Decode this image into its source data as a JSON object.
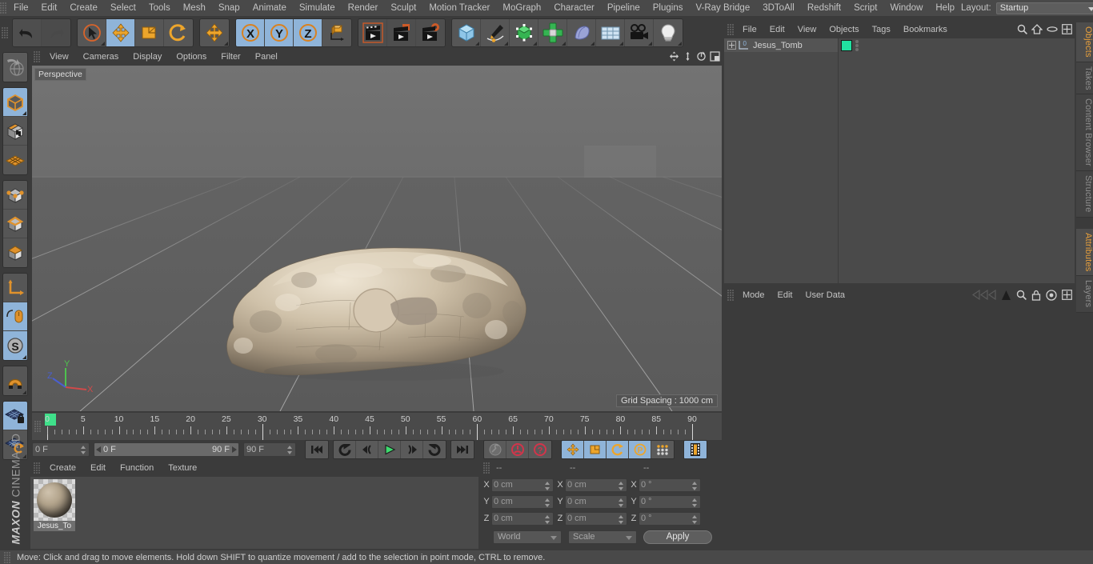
{
  "app": {
    "title": "MAXON CINEMA 4D",
    "brand_line1": "MAXON",
    "brand_line2": "CINEMA 4D"
  },
  "menubar": {
    "items": [
      "File",
      "Edit",
      "Create",
      "Select",
      "Tools",
      "Mesh",
      "Snap",
      "Animate",
      "Simulate",
      "Render",
      "Sculpt",
      "Motion Tracker",
      "MoGraph",
      "Character",
      "Pipeline",
      "Plugins",
      "V-Ray Bridge",
      "3DToAll",
      "Redshift",
      "Script",
      "Window",
      "Help"
    ],
    "layout_label": "Layout:",
    "layout_value": "Startup",
    "search_icon": "search-icon",
    "home_icon": "home-icon",
    "minimize_icon": "minimize-icon",
    "maximize_icon": "maximize-icon"
  },
  "toolbar": {
    "groups": [
      {
        "name": "undo-redo",
        "buttons": [
          {
            "name": "undo-button",
            "icon": "undo-icon",
            "state": "normal"
          },
          {
            "name": "redo-button",
            "icon": "redo-icon",
            "state": "disabled"
          }
        ]
      },
      {
        "name": "transform-tools",
        "buttons": [
          {
            "name": "live-selection-tool",
            "icon": "cursor-circle-icon",
            "state": "normal"
          },
          {
            "name": "move-tool",
            "icon": "move-arrows-icon",
            "state": "selected"
          },
          {
            "name": "scale-tool",
            "icon": "scale-box-icon",
            "state": "normal"
          },
          {
            "name": "rotate-tool",
            "icon": "rotate-arc-icon",
            "state": "normal"
          }
        ]
      },
      {
        "name": "move-duplicate",
        "buttons": [
          {
            "name": "move-duplicate-tool",
            "icon": "move-arrows-icon",
            "state": "normal"
          }
        ]
      },
      {
        "name": "axis-locks",
        "buttons": [
          {
            "name": "lock-x-axis",
            "icon": "x-axis-icon",
            "state": "selected"
          },
          {
            "name": "lock-y-axis",
            "icon": "y-axis-icon",
            "state": "selected"
          },
          {
            "name": "lock-z-axis",
            "icon": "z-axis-icon",
            "state": "selected"
          },
          {
            "name": "world-object-coordinates",
            "icon": "world-axis-icon",
            "state": "normal"
          }
        ]
      },
      {
        "name": "render-tools",
        "buttons": [
          {
            "name": "render-view-button",
            "icon": "render-view-icon",
            "state": "normal"
          },
          {
            "name": "render-to-picture-viewer-button",
            "icon": "render-picture-icon",
            "state": "normal"
          },
          {
            "name": "render-settings-button",
            "icon": "render-settings-icon",
            "state": "normal"
          }
        ]
      },
      {
        "name": "create-tools",
        "buttons": [
          {
            "name": "add-cube-button",
            "icon": "cube-icon",
            "state": "normal"
          },
          {
            "name": "add-spline-button",
            "icon": "pen-spline-icon",
            "state": "normal"
          },
          {
            "name": "add-nurbs-button",
            "icon": "green-cube-icon",
            "state": "normal"
          },
          {
            "name": "add-array-button",
            "icon": "array-icon",
            "state": "normal"
          },
          {
            "name": "add-bend-deformer-button",
            "icon": "deformer-icon",
            "state": "normal"
          },
          {
            "name": "add-floor-button",
            "icon": "floor-grid-icon",
            "state": "normal"
          },
          {
            "name": "add-camera-button",
            "icon": "camera-icon",
            "state": "normal"
          },
          {
            "name": "add-light-button",
            "icon": "light-bulb-icon",
            "state": "normal"
          }
        ]
      }
    ]
  },
  "left_toolbar": {
    "groups": [
      {
        "name": "undo-view-group",
        "buttons": [
          {
            "name": "undo-view-button",
            "icon": "globe-undo-icon",
            "state": "normal"
          }
        ]
      },
      {
        "name": "editable-modes-group",
        "buttons": [
          {
            "name": "make-editable-button",
            "icon": "editable-cube-icon",
            "state": "selected"
          },
          {
            "name": "model-mode-button",
            "icon": "texture-cube-icon",
            "state": "normal"
          },
          {
            "name": "texture-mode-button",
            "icon": "uv-mesh-icon",
            "state": "normal"
          }
        ]
      },
      {
        "name": "component-modes-group",
        "buttons": [
          {
            "name": "points-mode-button",
            "icon": "points-cube-icon",
            "state": "normal"
          },
          {
            "name": "edges-mode-button",
            "icon": "edges-cube-icon",
            "state": "normal"
          },
          {
            "name": "polygons-mode-button",
            "icon": "polygons-cube-icon",
            "state": "normal"
          }
        ]
      },
      {
        "name": "axis-group",
        "buttons": [
          {
            "name": "enable-axis-modification-button",
            "icon": "axis-l-icon",
            "state": "normal"
          },
          {
            "name": "enable-snapping-button",
            "icon": "mouse-axis-icon",
            "state": "selected"
          },
          {
            "name": "object-axis-button",
            "icon": "s-compass-icon",
            "state": "selected"
          }
        ]
      },
      {
        "name": "magnet-group",
        "buttons": [
          {
            "name": "magnet-tool-button",
            "icon": "magnet-icon",
            "state": "normal"
          }
        ]
      },
      {
        "name": "viewport-lock-group",
        "buttons": [
          {
            "name": "lock-workplane-button",
            "icon": "grid-lock-icon",
            "state": "selected"
          },
          {
            "name": "workplane-rotate-button",
            "icon": "grid-rotate-icon",
            "state": "normal"
          }
        ]
      }
    ]
  },
  "viewport": {
    "menu_items": [
      "View",
      "Cameras",
      "Display",
      "Options",
      "Filter",
      "Panel"
    ],
    "view_name": "Perspective",
    "grid_spacing": "Grid Spacing : 1000 cm",
    "axis_labels": {
      "x": "X",
      "y": "Y",
      "z": "Z"
    },
    "axis_colors": {
      "x": "#d04a4a",
      "y": "#4ec24e",
      "z": "#4a5fd0"
    },
    "corner_icons": [
      "pan-icon",
      "dolly-icon",
      "rotate-icon",
      "maximize-view-icon"
    ],
    "model_name": "Jesus_Tomb"
  },
  "timeline": {
    "tick_labels": [
      "0",
      "5",
      "10",
      "15",
      "20",
      "25",
      "30",
      "35",
      "40",
      "45",
      "50",
      "55",
      "60",
      "65",
      "70",
      "75",
      "80",
      "85",
      "90"
    ],
    "tick_values": [
      0,
      5,
      10,
      15,
      20,
      25,
      30,
      35,
      40,
      45,
      50,
      55,
      60,
      65,
      70,
      75,
      80,
      85,
      90
    ],
    "range_start": 0,
    "range_end": 90,
    "current_frame_field": "0 F",
    "current_frame_field_right": "0 F",
    "range_bar_start": "0 F",
    "range_bar_end": "90 F",
    "end_frame_field": "90 F",
    "transport_buttons": [
      {
        "name": "go-to-start-button",
        "icon": "skip-start-icon"
      },
      {
        "name": "play-backwards-loop-button",
        "icon": "loop-back-icon"
      },
      {
        "name": "step-back-button",
        "icon": "step-back-icon"
      },
      {
        "name": "play-button",
        "icon": "play-icon"
      },
      {
        "name": "step-forward-button",
        "icon": "step-forward-icon"
      },
      {
        "name": "play-forward-loop-button",
        "icon": "loop-forward-icon"
      },
      {
        "name": "go-to-end-button",
        "icon": "skip-end-icon"
      }
    ],
    "key_buttons": [
      {
        "name": "record-active-objects-button",
        "icon": "key-wrench-icon"
      },
      {
        "name": "autokeying-button",
        "icon": "autokey-icon"
      },
      {
        "name": "keyframe-selection-button",
        "icon": "question-key-icon"
      }
    ],
    "param_buttons": [
      {
        "name": "position-key-button",
        "icon": "move-arrows-icon",
        "state": "selected"
      },
      {
        "name": "scale-key-button",
        "icon": "scale-box-icon",
        "state": "selected"
      },
      {
        "name": "rotation-key-button",
        "icon": "rotate-arc-icon",
        "state": "selected"
      },
      {
        "name": "param-key-button",
        "icon": "p-circle-icon",
        "state": "selected"
      },
      {
        "name": "point-level-animation-button",
        "icon": "dots-grid-icon",
        "state": "normal"
      }
    ],
    "extra_button": {
      "name": "timeline-filmstrip-button",
      "icon": "filmstrip-icon",
      "state": "selected"
    }
  },
  "material_manager": {
    "menu_items": [
      "Create",
      "Edit",
      "Function",
      "Texture"
    ],
    "materials": [
      {
        "name": "Jesus_To",
        "full_name": "Jesus_Tomb"
      }
    ]
  },
  "coordinates": {
    "headers": [
      "--",
      "--",
      "--"
    ],
    "rows": [
      {
        "axis": "X",
        "position": "0 cm",
        "size": "0 cm",
        "rotation": "0 °"
      },
      {
        "axis": "Y",
        "position": "0 cm",
        "size": "0 cm",
        "rotation": "0 °"
      },
      {
        "axis": "Z",
        "position": "0 cm",
        "size": "0 cm",
        "rotation": "0 °"
      }
    ],
    "coord_system": "World",
    "size_mode": "Scale",
    "apply_label": "Apply"
  },
  "object_manager": {
    "menu_items": [
      "File",
      "Edit",
      "View",
      "Objects",
      "Tags",
      "Bookmarks"
    ],
    "icons": [
      "search-icon",
      "home-icon",
      "ellipse-icon",
      "layout-icon"
    ],
    "objects": [
      {
        "name": "Jesus_Tomb",
        "level": 0,
        "tag_color": "#21e0a0",
        "icon": "polygon-object-icon"
      }
    ]
  },
  "attribute_manager": {
    "menu_items": [
      "Mode",
      "Edit",
      "User Data"
    ],
    "icons": [
      "history-arrows-icon",
      "pin-up-icon",
      "search-icon",
      "lock-icon",
      "target-icon",
      "layout-icon"
    ]
  },
  "vertical_tabs": {
    "top": [
      {
        "label": "Objects",
        "active": true
      },
      {
        "label": "Takes",
        "active": false
      },
      {
        "label": "Content Browser",
        "active": false
      },
      {
        "label": "Structure",
        "active": false
      }
    ],
    "bottom": [
      {
        "label": "Attributes",
        "active": true
      },
      {
        "label": "Layers",
        "active": false
      }
    ]
  },
  "statusbar": {
    "text": "Move: Click and drag to move elements. Hold down SHIFT to quantize movement / add to the selection in point mode, CTRL to remove."
  },
  "colors": {
    "accent_orange": "#e79f3c",
    "selection_blue": "#8fb4d9",
    "tag_green": "#21e0a0",
    "panel_bg": "#3b3b3b",
    "field_bg": "#4f4f4f",
    "viewport_bg": "#646464"
  }
}
